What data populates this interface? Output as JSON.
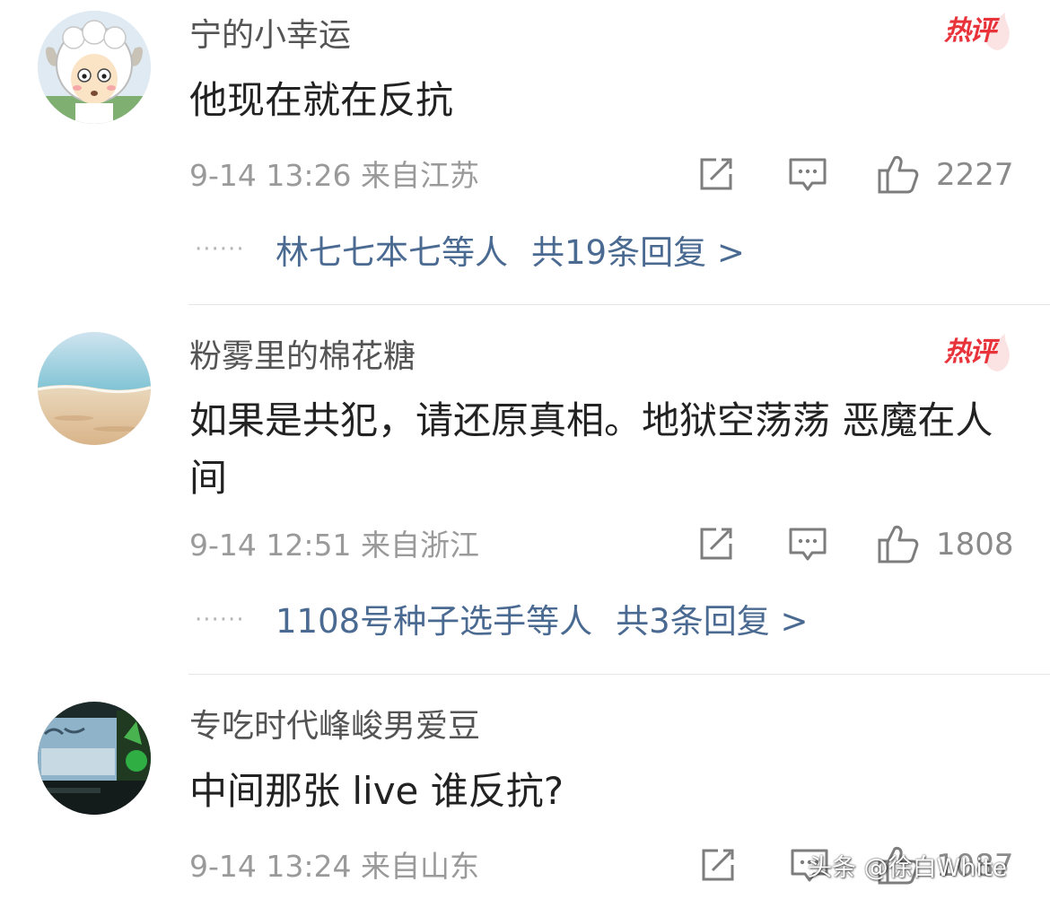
{
  "comments": [
    {
      "username": "宁的小幸运",
      "badge": "热评",
      "text": "他现在就在反抗",
      "meta": "9-14 13:26  来自江苏",
      "likes": "2227",
      "reply_dots": "······",
      "reply_users": "林七七本七等人",
      "reply_total": "共19条回复 >"
    },
    {
      "username": "粉雾里的棉花糖",
      "badge": "热评",
      "text": "如果是共犯，请还原真相。地狱空荡荡 恶魔在人间",
      "meta": "9-14 12:51  来自浙江",
      "likes": "1808",
      "reply_dots": "······",
      "reply_users": "1108号种子选手等人",
      "reply_total": "共3条回复 >"
    },
    {
      "username": "专吃时代峰峻男爱豆",
      "text": "中间那张 live 谁反抗?",
      "meta": "9-14 13:24  来自山东",
      "likes": "1087"
    }
  ],
  "watermark": "头条 @徐白White",
  "icons": {
    "repost": "edit-square-icon",
    "comment": "comment-bubble-icon",
    "like": "thumbs-up-icon"
  },
  "colors": {
    "hot_badge": "#e8333b",
    "reply_link": "#4a6a92",
    "meta": "#9a9a9a",
    "username": "#545454"
  }
}
